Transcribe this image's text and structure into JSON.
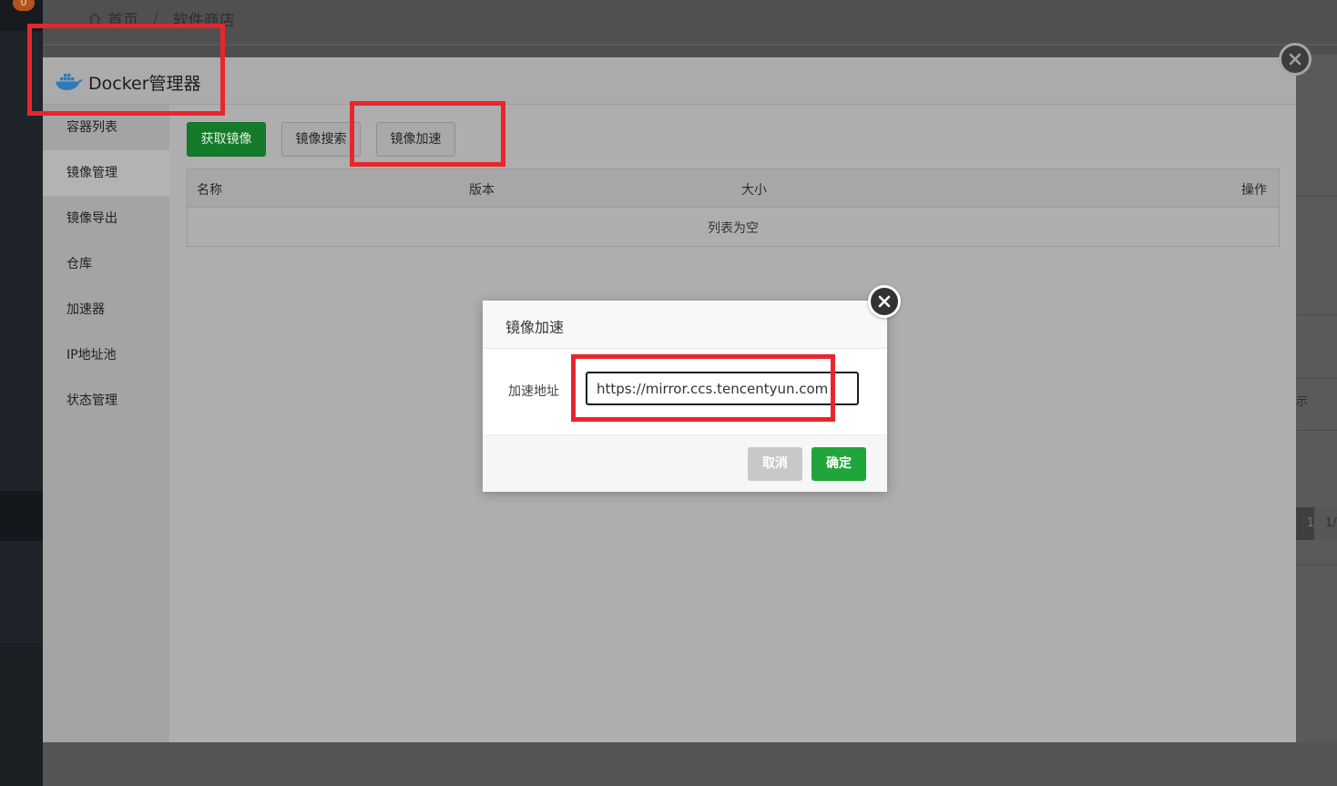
{
  "background": {
    "badge": "0",
    "breadcrumb": {
      "home": "首页",
      "separator": "/",
      "current": "软件商店"
    },
    "right_strip": {
      "text": "示",
      "page_current": "1",
      "page_total": "1/"
    }
  },
  "docker": {
    "title": "Docker管理器",
    "sidebar": [
      {
        "label": "容器列表",
        "active": false
      },
      {
        "label": "镜像管理",
        "active": true
      },
      {
        "label": "镜像导出",
        "active": false
      },
      {
        "label": "仓库",
        "active": false
      },
      {
        "label": "加速器",
        "active": false
      },
      {
        "label": "IP地址池",
        "active": false
      },
      {
        "label": "状态管理",
        "active": false
      }
    ],
    "toolbar": {
      "get_image": "获取镜像",
      "search_image": "镜像搜索",
      "image_accel": "镜像加速"
    },
    "table": {
      "columns": [
        "名称",
        "版本",
        "大小",
        "操作"
      ],
      "empty_text": "列表为空"
    }
  },
  "dialog": {
    "title": "镜像加速",
    "field_label": "加速地址",
    "field_value": "https://mirror.ccs.tencentyun.com",
    "cancel_label": "取消",
    "ok_label": "确定"
  },
  "colors": {
    "primary_green": "#20a53a",
    "highlight_red": "#e8262d",
    "docker_blue": "#2496ed"
  },
  "icons": [
    "home-icon",
    "docker-whale-icon",
    "close-icon"
  ]
}
